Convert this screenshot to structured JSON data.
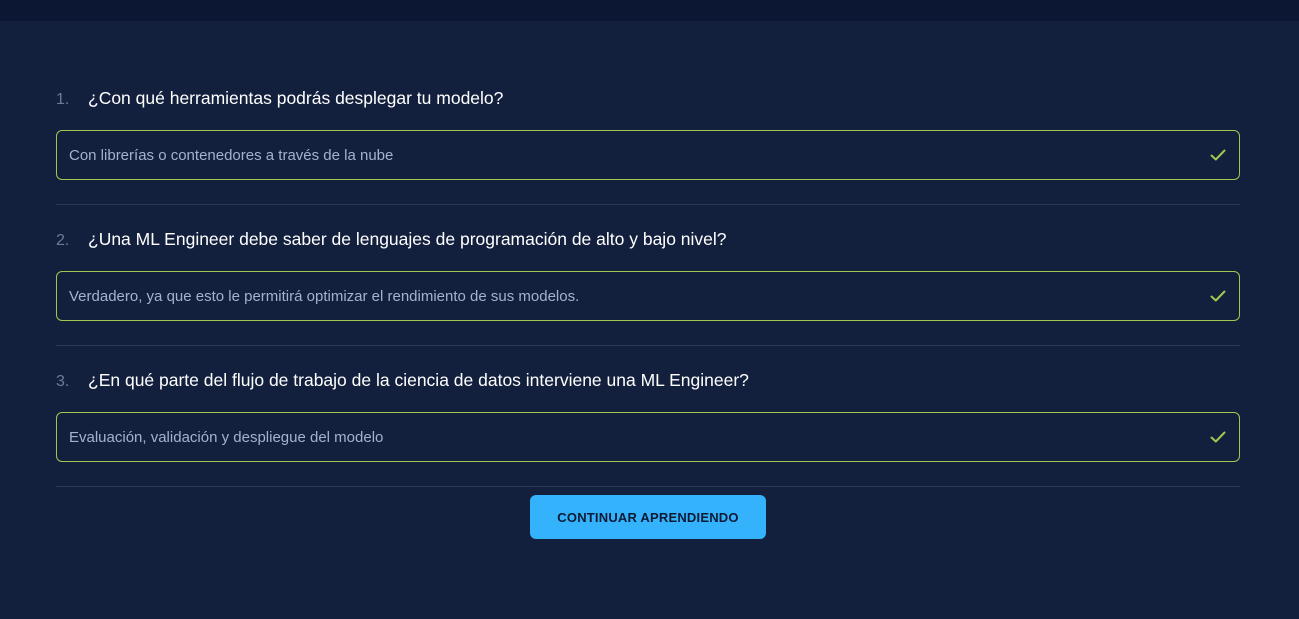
{
  "questions": [
    {
      "number": "1.",
      "text": "¿Con qué herramientas podrás desplegar tu modelo?",
      "answer": "Con librerías o contenedores a través de la nube",
      "status_icon": "check-icon"
    },
    {
      "number": "2.",
      "text": "¿Una ML Engineer debe saber de lenguajes de programación de alto y bajo nivel?",
      "answer": "Verdadero, ya que esto le permitirá optimizar el rendimiento de sus modelos.",
      "status_icon": "check-icon"
    },
    {
      "number": "3.",
      "text": "¿En qué parte del flujo de trabajo de la ciencia de datos interviene una ML Engineer?",
      "answer": "Evaluación, validación y despliegue del modelo",
      "status_icon": "check-icon"
    }
  ],
  "actions": {
    "continue_label": "CONTINUAR APRENDIENDO"
  },
  "colors": {
    "background": "#13203d",
    "topbar": "#0c1733",
    "correct_border": "#a1c84e",
    "check": "#a1c84e",
    "button": "#34b2fb"
  }
}
